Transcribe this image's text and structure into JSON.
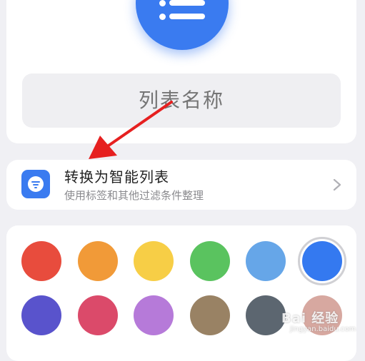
{
  "list_editor": {
    "name_placeholder": "列表名称",
    "icon": "list-icon",
    "icon_color": "#3a7bf0"
  },
  "smart_list": {
    "title": "转换为智能列表",
    "subtitle": "使用标签和其他过滤条件整理",
    "icon": "filter-icon",
    "chevron": "chevron-right-icon"
  },
  "annotation": {
    "arrow_color": "#e62020"
  },
  "colors": {
    "selected_index": 5,
    "swatches": [
      "#e84c3d",
      "#f19a38",
      "#f7ce46",
      "#5ac35f",
      "#66a6e8",
      "#3479f0",
      "#5953cc",
      "#db4a6a",
      "#b67ad9",
      "#998264",
      "#5c6670",
      "#d7a8a0"
    ]
  },
  "watermark": {
    "text": "Bai 经验",
    "sub": "jingyan.baidu.com"
  }
}
